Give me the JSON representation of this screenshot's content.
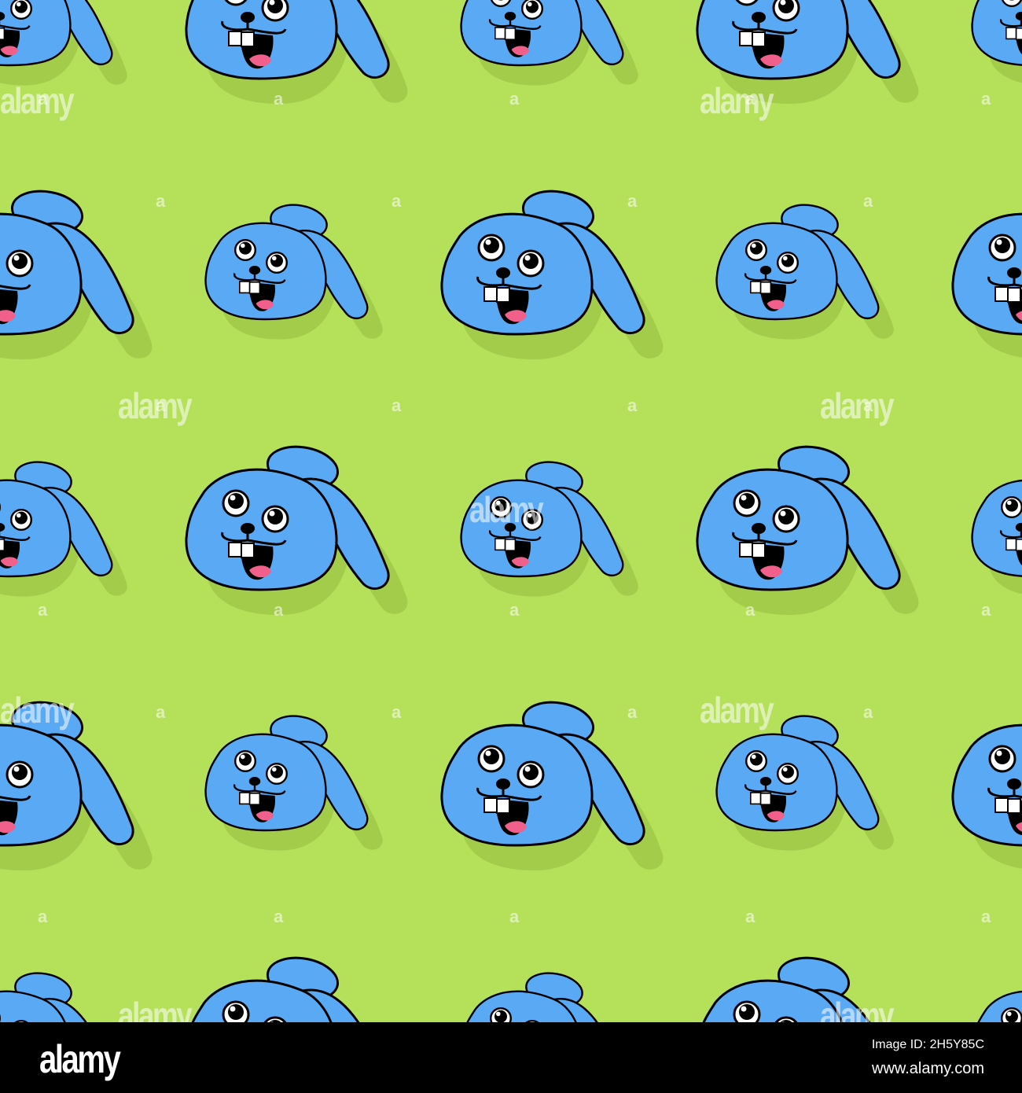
{
  "image": {
    "description_colors": {
      "background": "#b5e05a",
      "shadow": "#a2cc4a",
      "bunny": "#5aa9f5",
      "outline": "#000000",
      "tongue": "#f0608a"
    },
    "watermark_text": "alamy",
    "watermark_letter": "a"
  },
  "footer": {
    "logo": "alamy",
    "image_id": "Image ID: 2H5Y85C",
    "url": "www.alamy.com"
  }
}
